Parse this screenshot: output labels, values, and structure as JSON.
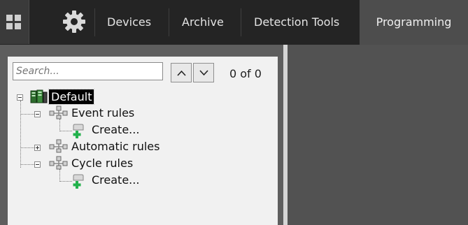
{
  "header": {
    "tabs": [
      {
        "label": "Devices"
      },
      {
        "label": "Archive"
      },
      {
        "label": "Detection Tools"
      },
      {
        "label": "Programming"
      }
    ],
    "active_tab": "Programming"
  },
  "search": {
    "placeholder": "Search...",
    "value": "",
    "counter": "0 of 0"
  },
  "tree": {
    "root": {
      "label": "Default",
      "icon": "server-rack-icon"
    },
    "groups": [
      {
        "label": "Event rules",
        "expanded": true,
        "children": [
          {
            "label": "Create...",
            "icon": "create-rule-icon"
          }
        ]
      },
      {
        "label": "Automatic rules",
        "expanded": false,
        "children": []
      },
      {
        "label": "Cycle rules",
        "expanded": true,
        "children": [
          {
            "label": "Create...",
            "icon": "create-rule-icon"
          }
        ]
      }
    ]
  },
  "icons": {
    "menu": "grid-icon",
    "settings": "gear-icon",
    "up": "chevron-up-icon",
    "down": "chevron-down-icon",
    "group": "rule-group-icon"
  },
  "colors": {
    "topbar": "#242424",
    "active_tab": "#4d4d4d",
    "panel": "#f1f1f1",
    "workspace": "#525252",
    "create_plus": "#22b14c"
  }
}
